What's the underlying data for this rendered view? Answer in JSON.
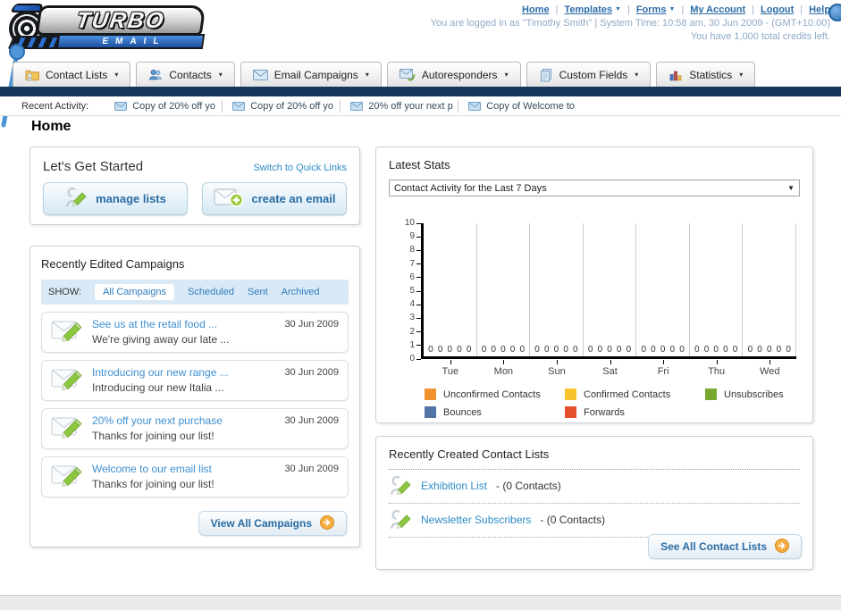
{
  "logo": {
    "line1": "TURBO",
    "line2": "EMAIL"
  },
  "header": {
    "nav_links": [
      {
        "label": "Home",
        "dropdown": false
      },
      {
        "label": "Templates",
        "dropdown": true
      },
      {
        "label": "Forms",
        "dropdown": true
      },
      {
        "label": "My Account",
        "dropdown": false
      },
      {
        "label": "Logout",
        "dropdown": false
      },
      {
        "label": "Help",
        "dropdown": false
      }
    ],
    "login_status": "You are logged in as \"Timothy Smith\" | System Time: 10:58 am, 30 Jun 2009 - (GMT+10:00)",
    "credits_line": "You have 1,000 total credits left."
  },
  "nav_tabs": [
    {
      "label": "Contact Lists",
      "icon": "folder-user"
    },
    {
      "label": "Contacts",
      "icon": "contacts"
    },
    {
      "label": "Email Campaigns",
      "icon": "envelope-nav"
    },
    {
      "label": "Autoresponders",
      "icon": "envelope-arrow"
    },
    {
      "label": "Custom Fields",
      "icon": "copy-pages"
    },
    {
      "label": "Statistics",
      "icon": "bar-chart"
    }
  ],
  "recent_activity": {
    "label": "Recent Activity:",
    "items": [
      "Copy of 20% off yo",
      "Copy of 20% off yo",
      "20% off your next p",
      "Copy of Welcome to"
    ]
  },
  "page": {
    "title": "Home"
  },
  "get_started": {
    "title": "Let's Get Started",
    "switch_link": "Switch to Quick Links",
    "manage_lists_label": "manage lists",
    "create_email_label": "create an email"
  },
  "campaigns": {
    "title": "Recently Edited Campaigns",
    "show_label": "SHOW:",
    "filters": [
      "All Campaigns",
      "Scheduled",
      "Sent",
      "Archived"
    ],
    "active_filter": "All Campaigns",
    "items": [
      {
        "title": "See us at the retail food ...",
        "subtitle": "We're giving away our late ...",
        "date": "30 Jun 2009"
      },
      {
        "title": "Introducing our new range ...",
        "subtitle": "Introducing our new Italia ...",
        "date": "30 Jun 2009"
      },
      {
        "title": "20% off your next purchase",
        "subtitle": "Thanks for joining our list!",
        "date": "30 Jun 2009"
      },
      {
        "title": "Welcome to our email list",
        "subtitle": "Thanks for joining our list!",
        "date": "30 Jun 2009"
      }
    ],
    "view_all_label": "View All Campaigns"
  },
  "stats": {
    "title": "Latest Stats",
    "dropdown_value": "Contact Activity for the Last 7 Days"
  },
  "chart_data": {
    "type": "bar",
    "title": "Contact Activity for the Last 7 Days",
    "categories": [
      "Tue",
      "Mon",
      "Sun",
      "Sat",
      "Fri",
      "Thu",
      "Wed"
    ],
    "series": [
      {
        "name": "Unconfirmed Contacts",
        "color": "#F2912D",
        "values": [
          0,
          0,
          0,
          0,
          0,
          0,
          0
        ]
      },
      {
        "name": "Confirmed Contacts",
        "color": "#F8C32C",
        "values": [
          0,
          0,
          0,
          0,
          0,
          0,
          0
        ]
      },
      {
        "name": "Unsubscribes",
        "color": "#76A832",
        "values": [
          0,
          0,
          0,
          0,
          0,
          0,
          0
        ]
      },
      {
        "name": "Bounces",
        "color": "#5273A6",
        "values": [
          0,
          0,
          0,
          0,
          0,
          0,
          0
        ]
      },
      {
        "name": "Forwards",
        "color": "#E6502D",
        "values": [
          0,
          0,
          0,
          0,
          0,
          0,
          0
        ]
      }
    ],
    "ylim": [
      0,
      10
    ],
    "yticks": [
      0,
      1,
      2,
      3,
      4,
      5,
      6,
      7,
      8,
      9,
      10
    ],
    "xlabel": "",
    "ylabel": "",
    "grid": "vertical",
    "legend_position": "bottom"
  },
  "contact_lists": {
    "title": "Recently Created Contact Lists",
    "items": [
      {
        "name": "Exhibition List",
        "suffix": " - (0 Contacts)"
      },
      {
        "name": "Newsletter Subscribers",
        "suffix": " - (0 Contacts)"
      }
    ],
    "see_all_label": "See All Contact Lists"
  }
}
